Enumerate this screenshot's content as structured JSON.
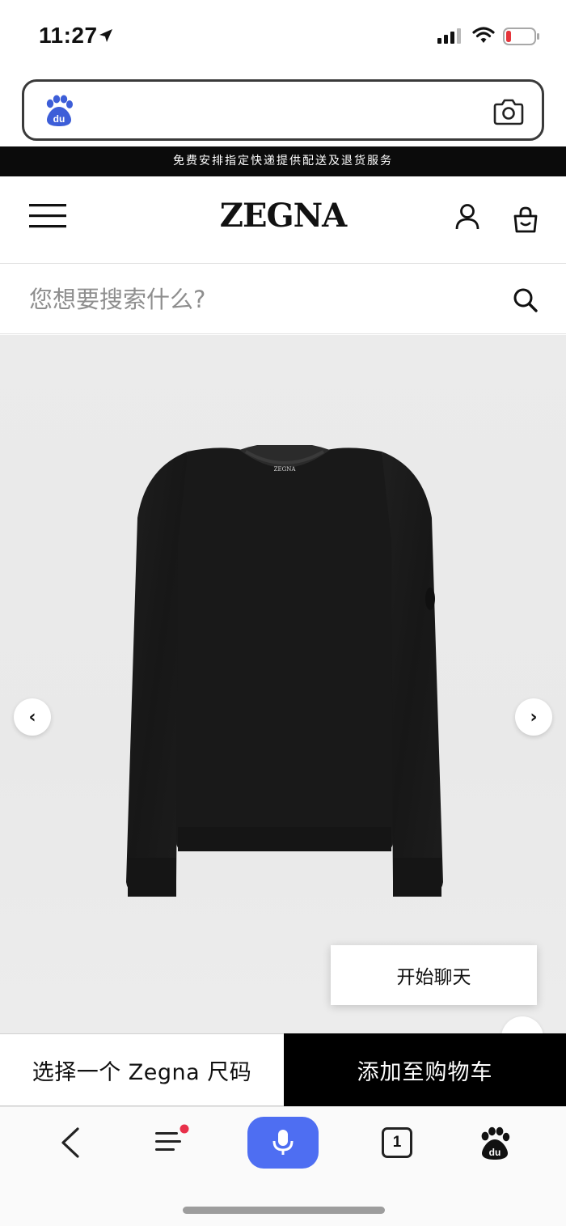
{
  "status_bar": {
    "time": "11:27",
    "location_icon": "location-arrow-icon",
    "signal_icon": "cellular-signal-icon",
    "wifi_icon": "wifi-icon",
    "battery_icon": "battery-low-icon",
    "battery_color": "#e5353b"
  },
  "browser": {
    "search_logo": "baidu-paw-icon",
    "camera_icon": "camera-icon"
  },
  "promo": {
    "text": "免费安排指定快递提供配送及退货服务"
  },
  "header": {
    "brand": "ZEGNA",
    "menu_icon": "hamburger-menu-icon",
    "account_icon": "user-icon",
    "bag_icon": "shopping-bag-icon"
  },
  "search": {
    "placeholder": "您想要搜索什么?",
    "value": ""
  },
  "gallery": {
    "prev_arrow": "‹",
    "next_arrow": "›",
    "product_label": "ZEGNA",
    "chat_label": "开始聊天"
  },
  "actions": {
    "size_label": "选择一个 Zegna 尺码",
    "cart_label": "添加至购物车"
  },
  "toolbar": {
    "tab_count": "1",
    "voice_color": "#4e6ef2",
    "notification_dot_color": "#e8304a"
  }
}
